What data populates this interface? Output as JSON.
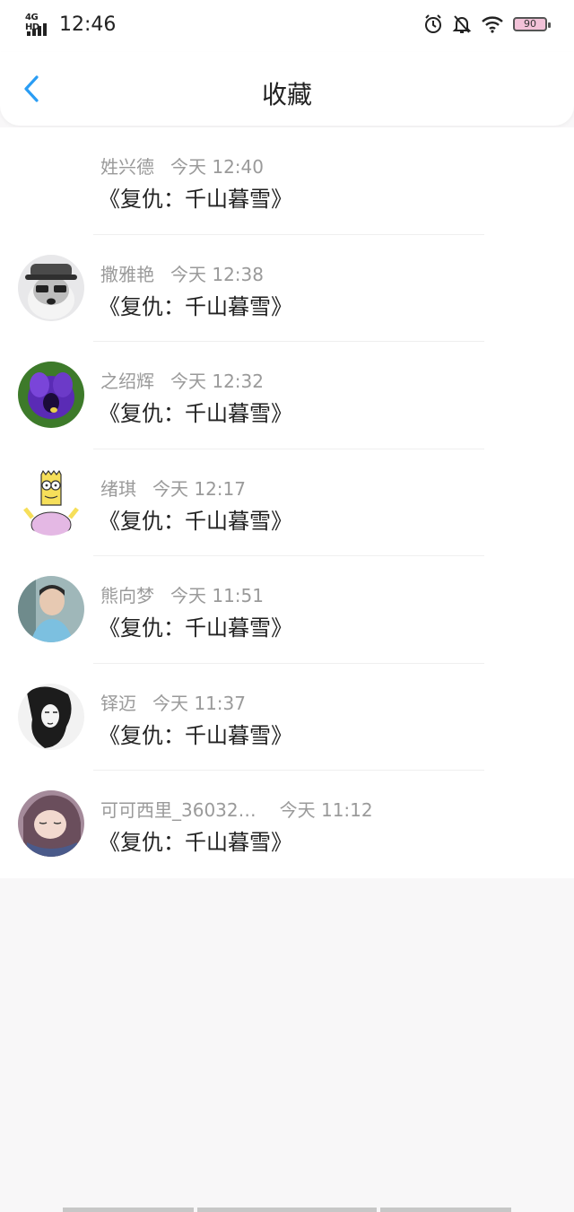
{
  "status": {
    "time": "12:46",
    "network": "4G HD",
    "battery": "90"
  },
  "header": {
    "title": "收藏"
  },
  "items": [
    {
      "user": "姓兴德",
      "date": "今天 12:40",
      "text": "《复仇：千山暮雪》",
      "avatar": "none"
    },
    {
      "user": "撒雅艳",
      "date": "今天 12:38",
      "text": "《复仇：千山暮雪》",
      "avatar": "dog-with-hat"
    },
    {
      "user": "之绍辉",
      "date": "今天 12:32",
      "text": "《复仇：千山暮雪》",
      "avatar": "purple-flower"
    },
    {
      "user": "绪琪",
      "date": "今天 12:17",
      "text": "《复仇：千山暮雪》",
      "avatar": "cartoon-character"
    },
    {
      "user": "熊向梦",
      "date": "今天 11:51",
      "text": "《复仇：千山暮雪》",
      "avatar": "man-photo"
    },
    {
      "user": "铎迈",
      "date": "今天 11:37",
      "text": "《复仇：千山暮雪》",
      "avatar": "bw-illustration"
    },
    {
      "user": "可可西里_36032…",
      "date": "今天 11:12",
      "text": "《复仇：千山暮雪》",
      "avatar": "anime-girl"
    }
  ]
}
